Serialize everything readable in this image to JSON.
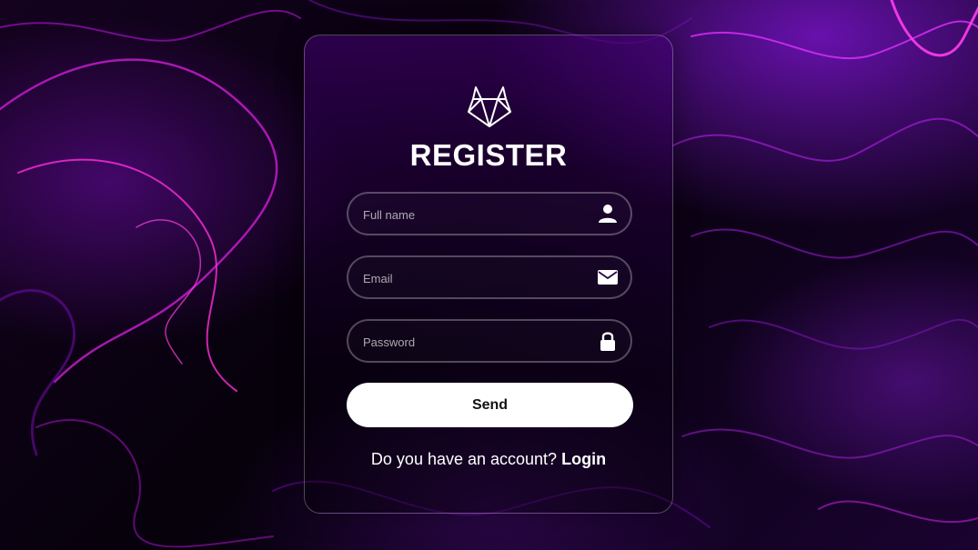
{
  "form": {
    "title": "REGISTER",
    "logo_icon": "fox-logo-icon",
    "fields": [
      {
        "placeholder": "Full name",
        "value": "",
        "icon": "user-icon"
      },
      {
        "placeholder": "Email",
        "value": "",
        "icon": "envelope-icon"
      },
      {
        "placeholder": "Password",
        "value": "",
        "icon": "lock-icon"
      }
    ],
    "submit_label": "Send",
    "account_prompt": "Do you have an account?",
    "login_link": "Login"
  },
  "colors": {
    "background_dark": "#06010b",
    "accent_purple": "#7a14c8",
    "neon_pink": "#e01ee0",
    "button_bg": "#ffffff",
    "text": "#ffffff"
  }
}
